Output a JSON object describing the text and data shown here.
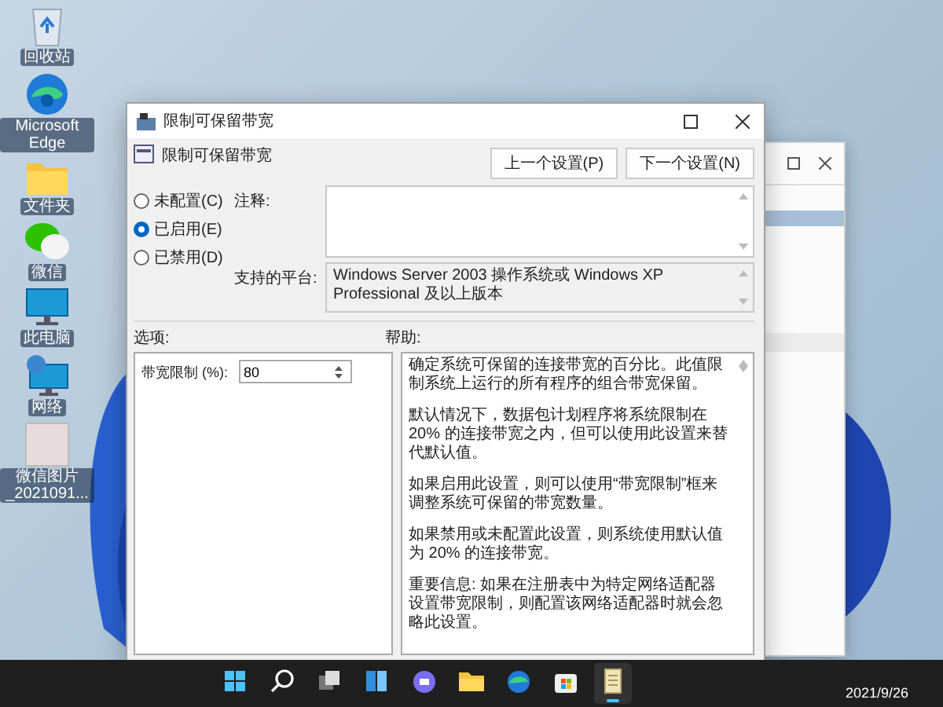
{
  "desktop_icons": [
    {
      "kind": "recycle",
      "label": "回收站"
    },
    {
      "kind": "edge",
      "label": "Microsoft Edge"
    },
    {
      "kind": "folder",
      "label": "文件夹"
    },
    {
      "kind": "wechat",
      "label": "微信"
    },
    {
      "kind": "computer",
      "label": "此电脑"
    },
    {
      "kind": "network",
      "label": "网络"
    },
    {
      "kind": "image",
      "label": "微信图片_2021091..."
    }
  ],
  "dialog": {
    "title": "限制可保留带宽",
    "header_title": "限制可保留带宽",
    "nav_buttons": [
      "上一个设置(P)",
      "下一个设置(N)"
    ],
    "state_options": [
      {
        "label": "未配置(C)",
        "selected": false
      },
      {
        "label": "已启用(E)",
        "selected": true
      },
      {
        "label": "已禁用(D)",
        "selected": false
      }
    ],
    "comment_label": "注释:",
    "platform_label": "支持的平台:",
    "platform": "Windows Server 2003 操作系统或 Windows XP Professional 及以上版本",
    "options_label": "选项:",
    "help_label": "帮助:",
    "options": [
      {
        "label": "带宽限制 (%):",
        "value": "80"
      }
    ],
    "help": [
      "确定系统可保留的连接带宽的百分比。此值限制系统上运行的所有程序的组合带宽保留。",
      "默认情况下，数据包计划程序将系统限制在 20% 的连接带宽之内，但可以使用此设置来替代默认值。",
      "如果启用此设置，则可以使用“带宽限制”框来调整系统可保留的带宽数量。",
      "如果禁用或未配置此设置，则系统使用默认值为 20% 的连接带宽。",
      "重要信息: 如果在注册表中为特定网络适配器设置带宽限制，则配置该网络适配器时就会忽略此设置。"
    ]
  },
  "taskbar": {
    "apps": [
      {
        "kind": "start",
        "active": false
      },
      {
        "kind": "search",
        "active": false
      },
      {
        "kind": "taskview",
        "active": false
      },
      {
        "kind": "widgets",
        "active": false
      },
      {
        "kind": "chat",
        "active": false
      },
      {
        "kind": "explorer",
        "active": false
      },
      {
        "kind": "edge",
        "active": false
      },
      {
        "kind": "store",
        "active": false
      },
      {
        "kind": "notepad",
        "active": true
      }
    ],
    "date": "2021/9/26"
  }
}
